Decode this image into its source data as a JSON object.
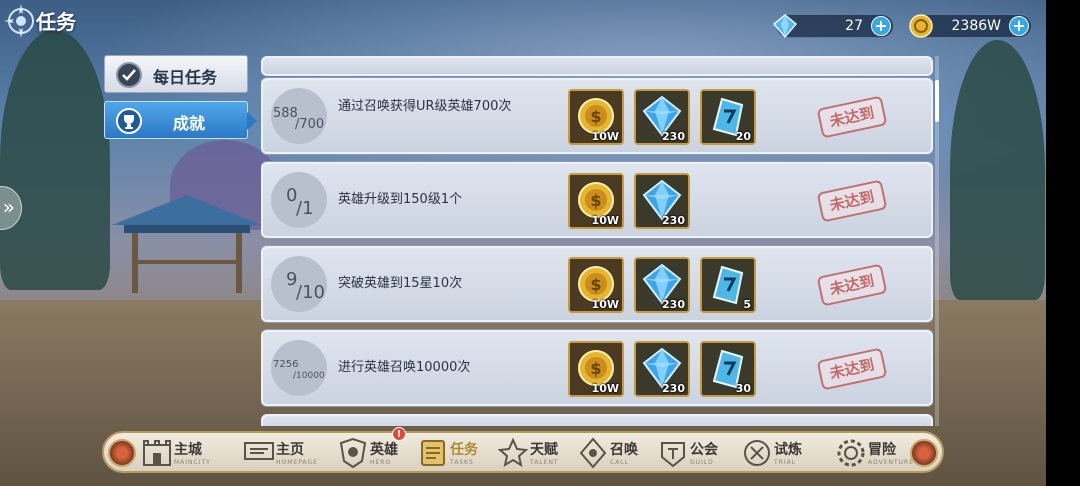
{
  "header": {
    "title": "任务"
  },
  "currency": {
    "gem": {
      "value": "27",
      "icon": "gem-icon",
      "plus": "+"
    },
    "gold": {
      "value": "2386W",
      "icon": "gold-coin-icon",
      "plus": "+"
    }
  },
  "side_nav": {
    "daily": {
      "label": "每日任务",
      "icon": "daily-task-icon"
    },
    "achievement": {
      "label": "成就",
      "icon": "achievement-icon",
      "selected": true
    }
  },
  "side_arrow": "»",
  "tasks": [
    {
      "progress_current": "588",
      "progress_total": "/700",
      "description": "通过召唤获得UR级英雄700次",
      "rewards": [
        {
          "type": "gold",
          "amount": "10W"
        },
        {
          "type": "diamond",
          "amount": "230"
        },
        {
          "type": "crystal",
          "amount": "20"
        }
      ],
      "status": "未达到"
    },
    {
      "progress_current": "0",
      "progress_total": "/1",
      "description": "英雄升级到150级1个",
      "rewards": [
        {
          "type": "gold",
          "amount": "10W"
        },
        {
          "type": "diamond",
          "amount": "230"
        }
      ],
      "status": "未达到"
    },
    {
      "progress_current": "9",
      "progress_total": "/10",
      "description": "突破英雄到15星10次",
      "rewards": [
        {
          "type": "gold",
          "amount": "10W"
        },
        {
          "type": "diamond",
          "amount": "230"
        },
        {
          "type": "crystal",
          "amount": "5"
        }
      ],
      "status": "未达到"
    },
    {
      "progress_current": "7256",
      "progress_total": "/10000",
      "description": "进行英雄召唤10000次",
      "rewards": [
        {
          "type": "gold",
          "amount": "10W"
        },
        {
          "type": "diamond",
          "amount": "230"
        },
        {
          "type": "crystal",
          "amount": "30"
        }
      ],
      "status": "未达到"
    }
  ],
  "bottom_nav": [
    {
      "label": "主城",
      "sub": "MAINCITY",
      "icon": "castle-icon"
    },
    {
      "label": "主页",
      "sub": "HOMEPAGE",
      "icon": "home-sign-icon"
    },
    {
      "label": "英雄",
      "sub": "HERO",
      "icon": "hero-icon",
      "badge": "!"
    },
    {
      "label": "任务",
      "sub": "TASKS",
      "icon": "task-scroll-icon"
    },
    {
      "label": "天赋",
      "sub": "TALENT",
      "icon": "talent-icon"
    },
    {
      "label": "召唤",
      "sub": "CALL",
      "icon": "summon-icon"
    },
    {
      "label": "公会",
      "sub": "GUILD",
      "icon": "guild-icon"
    },
    {
      "label": "试炼",
      "sub": "TRIAL",
      "icon": "trial-icon"
    },
    {
      "label": "冒险",
      "sub": "ADVENTURE",
      "icon": "adventure-gear-icon"
    }
  ],
  "colors": {
    "accent": "#2c78c4",
    "gold_border": "#c79a3f",
    "stamp": "#c36a6a"
  }
}
